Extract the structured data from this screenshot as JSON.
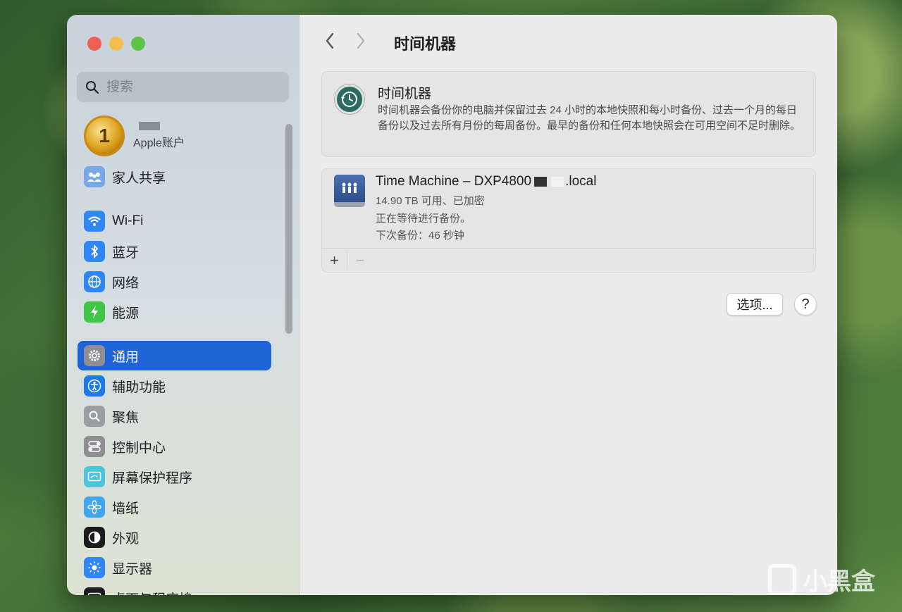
{
  "sidebar": {
    "search_placeholder": "搜索",
    "account": {
      "avatar_text": "1",
      "subtitle": "Apple账户"
    },
    "items": [
      {
        "label": "家人共享",
        "icon": "family-icon",
        "color": "#7aa7e8"
      },
      {
        "label": "Wi-Fi",
        "icon": "wifi-icon",
        "color": "#2f86f6"
      },
      {
        "label": "蓝牙",
        "icon": "bluetooth-icon",
        "color": "#2f86f6"
      },
      {
        "label": "网络",
        "icon": "globe-icon",
        "color": "#2f86f6"
      },
      {
        "label": "能源",
        "icon": "bolt-icon",
        "color": "#3fc547"
      },
      {
        "label": "通用",
        "icon": "gear-icon",
        "color": "#8e8e93",
        "active": true
      },
      {
        "label": "辅助功能",
        "icon": "accessibility-icon",
        "color": "#1f78e8"
      },
      {
        "label": "聚焦",
        "icon": "magnifier-icon",
        "color": "#9a9ea3"
      },
      {
        "label": "控制中心",
        "icon": "toggles-icon",
        "color": "#8e8e93"
      },
      {
        "label": "屏幕保护程序",
        "icon": "screensaver-icon",
        "color": "#4ec3de"
      },
      {
        "label": "墙纸",
        "icon": "flower-icon",
        "color": "#3fa6ef"
      },
      {
        "label": "外观",
        "icon": "appearance-icon",
        "color": "#1c1c1e"
      },
      {
        "label": "显示器",
        "icon": "sun-icon",
        "color": "#2f86f6"
      },
      {
        "label": "桌面与程序坞",
        "icon": "dock-icon",
        "color": "#1c1c1e"
      }
    ]
  },
  "main": {
    "title": "时间机器",
    "info": {
      "title": "时间机器",
      "description": "时间机器会备份你的电脑并保留过去 24 小时的本地快照和每小时备份、过去一个月的每日备份以及过去所有月份的每周备份。最早的备份和任何本地快照会在可用空间不足时删除。"
    },
    "disk": {
      "name": "Time Machine – DXP4800",
      "name_suffix": ".local",
      "capacity": "14.90 TB 可用、已加密",
      "status": "正在等待进行备份。",
      "next": "下次备份：46 秒钟"
    },
    "footer": {
      "add": "+",
      "remove": "−"
    },
    "options_label": "选项...",
    "help_label": "?"
  },
  "watermark": {
    "text": "小黑盒"
  }
}
